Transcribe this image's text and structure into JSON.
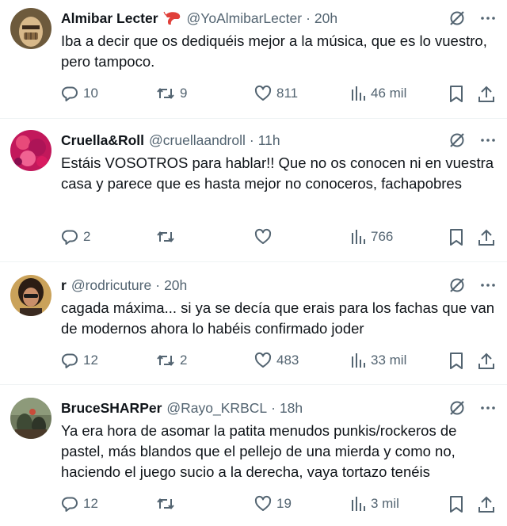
{
  "tweets": [
    {
      "name": "Almibar Lecter",
      "has_emoji": true,
      "emoji_icon": "shrimp-icon",
      "handle": "@YoAlmibarLecter",
      "separator": "·",
      "time": "20h",
      "text": "Iba a decir que os dediquéis mejor a la música, que es lo vuestro, pero tampoco.",
      "replies": "10",
      "reposts": "9",
      "likes": "811",
      "views": "46 mil"
    },
    {
      "name": "Cruella&Roll",
      "has_emoji": false,
      "handle": "@cruellaandroll",
      "separator": "·",
      "time": "11h",
      "text": "Estáis VOSOTROS para hablar!! Que no os conocen ni en vuestra casa y parece que es hasta mejor no conoceros, fachapobres",
      "replies": "2",
      "reposts": "",
      "likes": "",
      "views": "766"
    },
    {
      "name": "r",
      "has_emoji": false,
      "handle": "@rodricuture",
      "separator": "·",
      "time": "20h",
      "text": "cagada máxima... si ya se decía que erais para los fachas que van de modernos ahora lo habéis confirmado joder",
      "replies": "12",
      "reposts": "2",
      "likes": "483",
      "views": "33 mil"
    },
    {
      "name": "BruceSHARPer",
      "has_emoji": false,
      "handle": "@Rayo_KRBCL",
      "separator": "·",
      "time": "18h",
      "text": "Ya era hora de asomar la patita menudos punkis/rockeros de pastel, más blandos que el pellejo de una mierda y como no, haciendo el juego sucio a la derecha,  vaya tortazo tenéis",
      "replies": "12",
      "reposts": "",
      "likes": "19",
      "views": "3 mil"
    }
  ],
  "colors": {
    "text": "#0f1419",
    "secondary": "#536471",
    "divider": "#eff3f4",
    "emoji_shrimp": "#e0403a"
  },
  "icons": {
    "reply": "reply-icon",
    "repost": "repost-icon",
    "like": "heart-icon",
    "views": "views-chart-icon",
    "bookmark": "bookmark-icon",
    "share": "share-icon",
    "grok": "grok-icon",
    "more": "more-icon"
  }
}
